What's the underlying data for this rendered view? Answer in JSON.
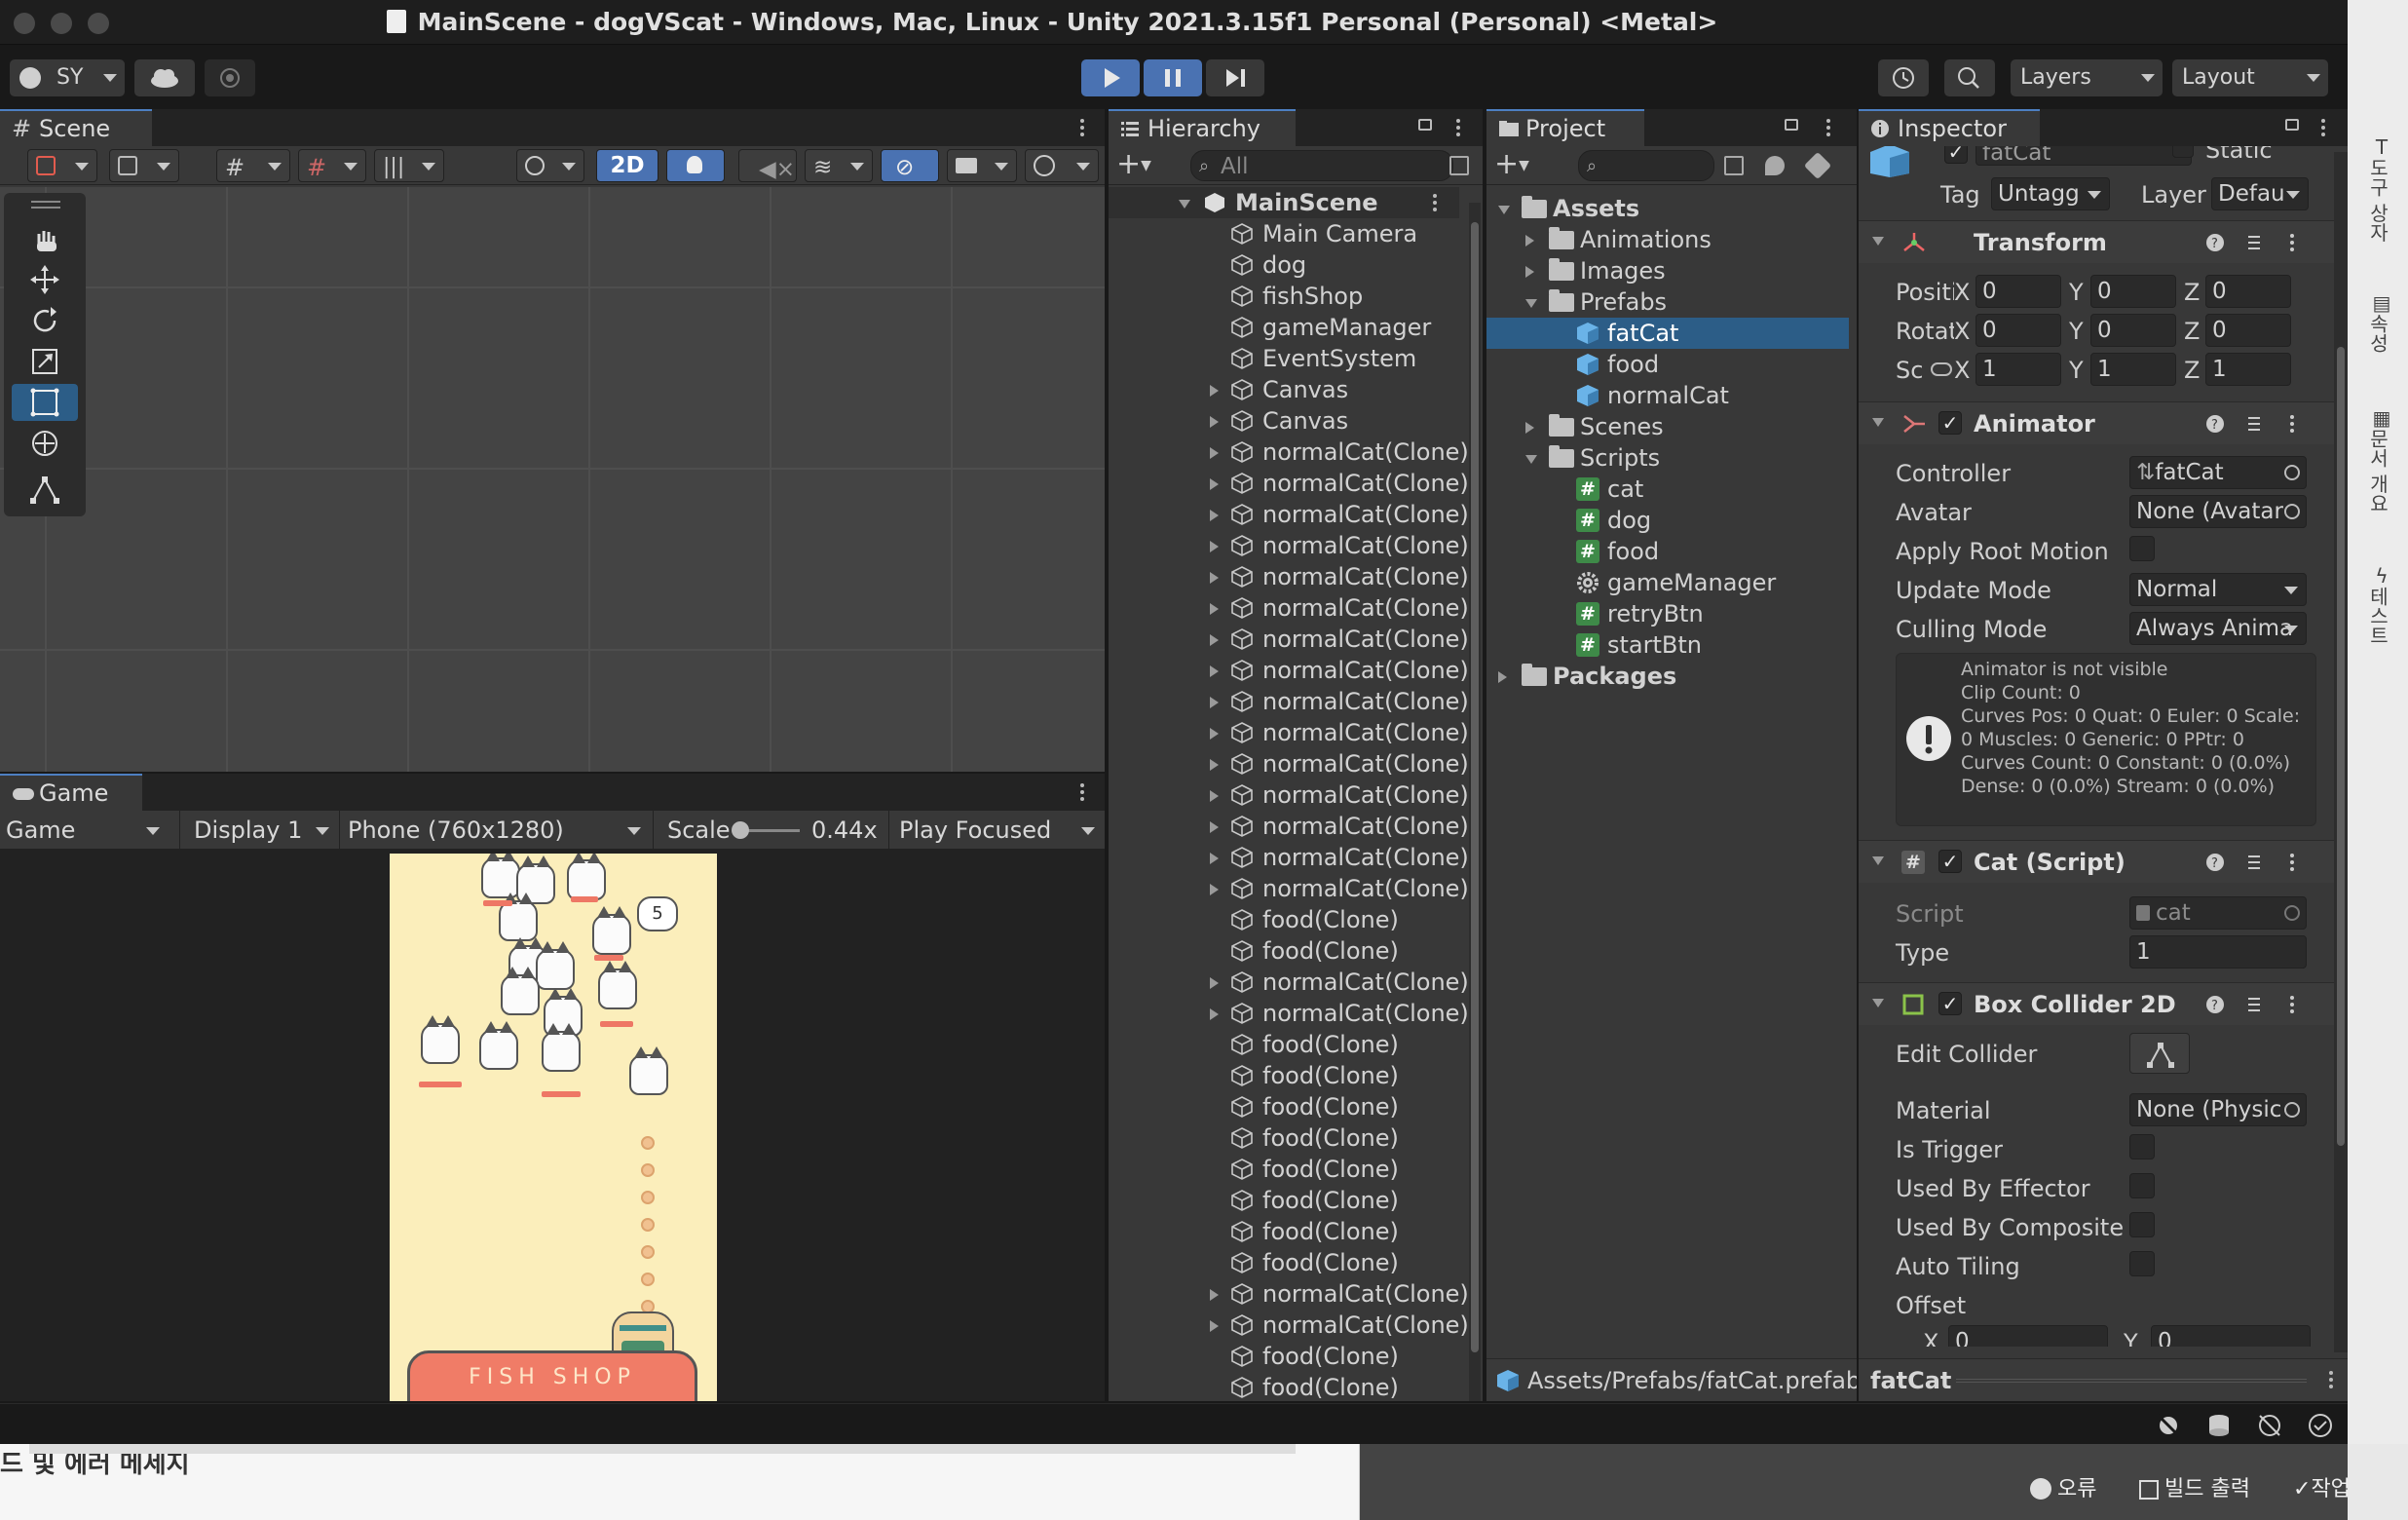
{
  "window": {
    "title": "MainScene - dogVScat - Windows, Mac, Linux - Unity 2021.3.15f1 Personal (Personal) <Metal>"
  },
  "toolbar": {
    "account": "SY",
    "layers": "Layers",
    "layout": "Layout"
  },
  "scene": {
    "tab": "Scene",
    "mode_2d": "2D"
  },
  "game": {
    "tab": "Game",
    "view_select": "Game",
    "display_select": "Display 1",
    "resolution_select": "Phone (760x1280)",
    "scale_label": "Scale",
    "scale_value": "0.44x",
    "play_mode_select": "Play Focused",
    "shop_sign": "FISH SHOP",
    "counter_badge": "5",
    "scale_level": 0.05
  },
  "hierarchy": {
    "tab": "Hierarchy",
    "search_placeholder": "All",
    "scene_name": "MainScene",
    "items": [
      {
        "name": "Main Camera",
        "expandable": false
      },
      {
        "name": "dog",
        "expandable": false
      },
      {
        "name": "fishShop",
        "expandable": false
      },
      {
        "name": "gameManager",
        "expandable": false
      },
      {
        "name": "EventSystem",
        "expandable": false
      },
      {
        "name": "Canvas",
        "expandable": true
      },
      {
        "name": "Canvas",
        "expandable": true
      },
      {
        "name": "normalCat(Clone)",
        "expandable": true
      },
      {
        "name": "normalCat(Clone)",
        "expandable": true
      },
      {
        "name": "normalCat(Clone)",
        "expandable": true
      },
      {
        "name": "normalCat(Clone)",
        "expandable": true
      },
      {
        "name": "normalCat(Clone)",
        "expandable": true
      },
      {
        "name": "normalCat(Clone)",
        "expandable": true
      },
      {
        "name": "normalCat(Clone)",
        "expandable": true
      },
      {
        "name": "normalCat(Clone)",
        "expandable": true
      },
      {
        "name": "normalCat(Clone)",
        "expandable": true
      },
      {
        "name": "normalCat(Clone)",
        "expandable": true
      },
      {
        "name": "normalCat(Clone)",
        "expandable": true
      },
      {
        "name": "normalCat(Clone)",
        "expandable": true
      },
      {
        "name": "normalCat(Clone)",
        "expandable": true
      },
      {
        "name": "normalCat(Clone)",
        "expandable": true
      },
      {
        "name": "normalCat(Clone)",
        "expandable": true
      },
      {
        "name": "food(Clone)",
        "expandable": false
      },
      {
        "name": "food(Clone)",
        "expandable": false
      },
      {
        "name": "normalCat(Clone)",
        "expandable": true
      },
      {
        "name": "normalCat(Clone)",
        "expandable": true
      },
      {
        "name": "food(Clone)",
        "expandable": false
      },
      {
        "name": "food(Clone)",
        "expandable": false
      },
      {
        "name": "food(Clone)",
        "expandable": false
      },
      {
        "name": "food(Clone)",
        "expandable": false
      },
      {
        "name": "food(Clone)",
        "expandable": false
      },
      {
        "name": "food(Clone)",
        "expandable": false
      },
      {
        "name": "food(Clone)",
        "expandable": false
      },
      {
        "name": "food(Clone)",
        "expandable": false
      },
      {
        "name": "normalCat(Clone)",
        "expandable": true
      },
      {
        "name": "normalCat(Clone)",
        "expandable": true
      },
      {
        "name": "food(Clone)",
        "expandable": false
      },
      {
        "name": "food(Clone)",
        "expandable": false
      }
    ]
  },
  "project": {
    "tab": "Project",
    "tree": [
      {
        "name": "Assets",
        "kind": "folder-open",
        "depth": 0,
        "bold": true
      },
      {
        "name": "Animations",
        "kind": "folder",
        "depth": 1
      },
      {
        "name": "Images",
        "kind": "folder",
        "depth": 1
      },
      {
        "name": "Prefabs",
        "kind": "folder-open",
        "depth": 1
      },
      {
        "name": "fatCat",
        "kind": "prefab",
        "depth": 2,
        "selected": true
      },
      {
        "name": "food",
        "kind": "prefab",
        "depth": 2
      },
      {
        "name": "normalCat",
        "kind": "prefab",
        "depth": 2
      },
      {
        "name": "Scenes",
        "kind": "folder",
        "depth": 1
      },
      {
        "name": "Scripts",
        "kind": "folder-open",
        "depth": 1
      },
      {
        "name": "cat",
        "kind": "script",
        "depth": 2
      },
      {
        "name": "dog",
        "kind": "script",
        "depth": 2
      },
      {
        "name": "food",
        "kind": "script",
        "depth": 2
      },
      {
        "name": "gameManager",
        "kind": "gear",
        "depth": 2
      },
      {
        "name": "retryBtn",
        "kind": "script",
        "depth": 2
      },
      {
        "name": "startBtn",
        "kind": "script",
        "depth": 2
      },
      {
        "name": "Packages",
        "kind": "folder",
        "depth": 0,
        "bold": true
      }
    ],
    "footer_path": "Assets/Prefabs/fatCat.prefab"
  },
  "inspector": {
    "tab": "Inspector",
    "object_name": "fatCat",
    "static_label": "Static",
    "tag_label": "Tag",
    "tag_value": "Untagg",
    "layer_label": "Layer",
    "layer_value": "Defau",
    "transform": {
      "title": "Transform",
      "position_label": "Positio",
      "rotation_label": "Rotatio",
      "scale_label": "Sc",
      "position": [
        "0",
        "0",
        "0"
      ],
      "rotation": [
        "0",
        "0",
        "0"
      ],
      "scale": [
        "1",
        "1",
        "1"
      ],
      "x": "X",
      "y": "Y",
      "z": "Z"
    },
    "animator": {
      "title": "Animator",
      "controller_label": "Controller",
      "controller_value": "fatCat",
      "avatar_label": "Avatar",
      "avatar_value": "None (Avatar",
      "apply_root_motion_label": "Apply Root Motion",
      "update_mode_label": "Update Mode",
      "update_mode_value": "Normal",
      "culling_mode_label": "Culling Mode",
      "culling_mode_value": "Always Anima",
      "info_lines": [
        "Animator is not visible",
        "Clip Count: 0",
        "Curves Pos: 0 Quat: 0 Euler: 0 Scale:",
        "0 Muscles: 0 Generic: 0 PPtr: 0",
        "Curves Count: 0 Constant: 0 (0.0%)",
        "Dense: 0 (0.0%) Stream: 0 (0.0%)"
      ]
    },
    "cat_script": {
      "title": "Cat (Script)",
      "script_label": "Script",
      "script_value": "cat",
      "type_label": "Type",
      "type_value": "1"
    },
    "box_collider": {
      "title": "Box Collider 2D",
      "edit_collider_label": "Edit Collider",
      "material_label": "Material",
      "material_value": "None (Physic",
      "is_trigger_label": "Is Trigger",
      "used_by_effector_label": "Used By Effector",
      "used_by_composite_label": "Used By Composite",
      "auto_tiling_label": "Auto Tiling",
      "offset_label": "Offset",
      "offset_x_label": "X",
      "offset_x": "0",
      "offset_y_label": "Y",
      "offset_y": "0"
    },
    "footer_name": "fatCat"
  },
  "background": {
    "console_text": "드 및 에러 메세지",
    "status_errors": "오류",
    "status_build": "빌드 출력",
    "status_tasks": "작업",
    "side_labels": [
      "도구 상자",
      "속성",
      "문서 개요",
      "테스트"
    ]
  },
  "colors": {
    "accent": "#4d7fc2",
    "selection": "#2c5d87",
    "play_active": "#4a72b2",
    "game_bg": "#fbeebb"
  }
}
